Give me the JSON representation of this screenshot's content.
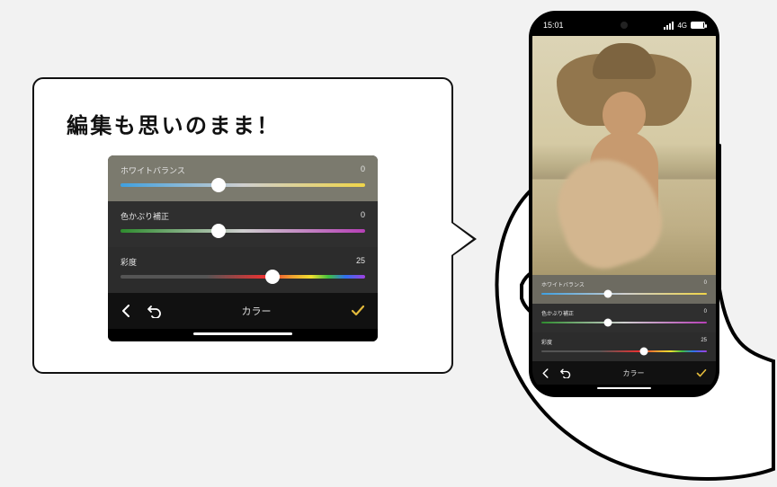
{
  "callout": {
    "headline": "編集も思いのまま！"
  },
  "statusbar": {
    "time": "15:01",
    "network": "4G"
  },
  "editor": {
    "rows": [
      {
        "label": "ホワイトバランス",
        "value": "0",
        "thumb_pct": 40
      },
      {
        "label": "色かぶり補正",
        "value": "0",
        "thumb_pct": 40
      },
      {
        "label": "彩度",
        "value": "25",
        "thumb_pct": 62
      }
    ],
    "tab_title": "カラー"
  },
  "colors": {
    "accent_confirm": "#E2B93B"
  }
}
